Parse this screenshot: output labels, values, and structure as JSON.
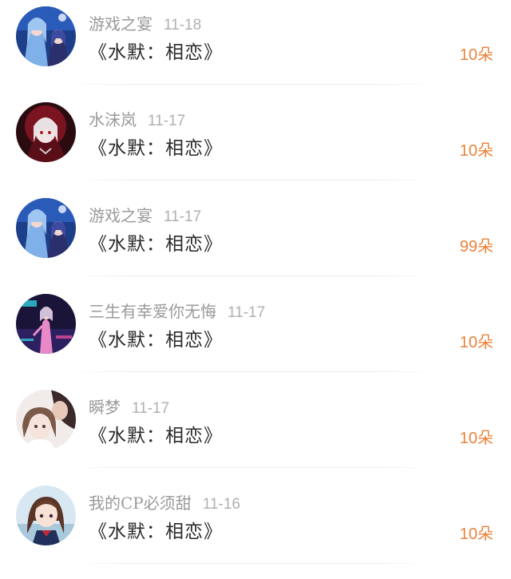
{
  "rows": [
    {
      "user": "游戏之宴",
      "date": "11-18",
      "gift": "《水默：相恋》",
      "count": "10朵",
      "avatar": "anime-duo-blue-avatar"
    },
    {
      "user": "水沫岚",
      "date": "11-17",
      "gift": "《水默：相恋》",
      "count": "10朵",
      "avatar": "anime-girl-red-hood-avatar"
    },
    {
      "user": "游戏之宴",
      "date": "11-17",
      "gift": "《水默：相恋》",
      "count": "99朵",
      "avatar": "anime-duo-blue-avatar"
    },
    {
      "user": "三生有幸爱你无悔",
      "date": "11-17",
      "gift": "《水默：相恋》",
      "count": "10朵",
      "avatar": "anime-pink-neon-avatar"
    },
    {
      "user": "瞬梦",
      "date": "11-17",
      "gift": "《水默：相恋》",
      "count": "10朵",
      "avatar": "anime-couple-avatar"
    },
    {
      "user": "我的CP必须甜",
      "date": "11-16",
      "gift": "《水默：相恋》",
      "count": "10朵",
      "avatar": "anime-schoolgirl-avatar"
    }
  ],
  "colors": {
    "count": "#e8833a",
    "username": "#9a9a9a",
    "date": "#b0b0b0",
    "gift": "#2a2a2a"
  }
}
